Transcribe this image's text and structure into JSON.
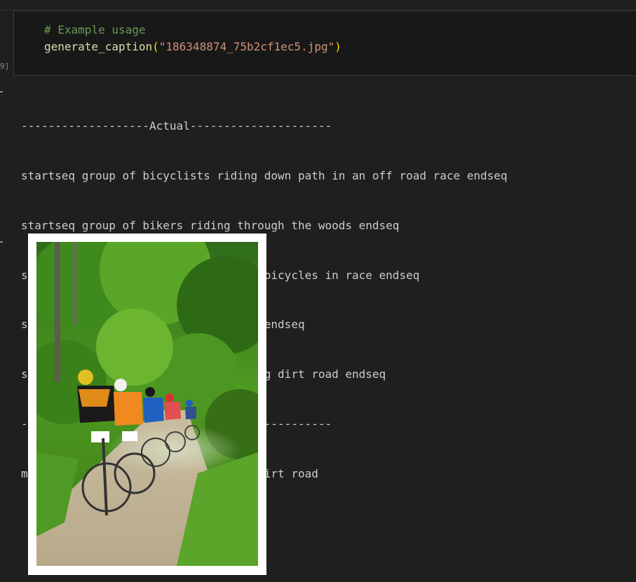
{
  "input_cell": {
    "execution_count": "9]",
    "comment": "# Example usage",
    "fn_name": "generate_caption",
    "open_paren": "(",
    "argument": "\"186348874_75b2cf1ec5.jpg\"",
    "close_paren": ")"
  },
  "output": {
    "lines": [
      "-------------------Actual---------------------",
      "startseq group of bicyclists riding down path in an off road race endseq",
      "startseq group of bikers riding through the woods endseq",
      "startseq group of people are riding bicycles in race endseq",
      "startseq bikers race through forest endseq",
      "startseq many bicyclists racing along dirt road endseq",
      "----------------Predicted---------------------",
      "many people are riding bicycles on dirt road"
    ]
  },
  "image": {
    "subject": "mountain bikers racing on forest dirt road"
  }
}
